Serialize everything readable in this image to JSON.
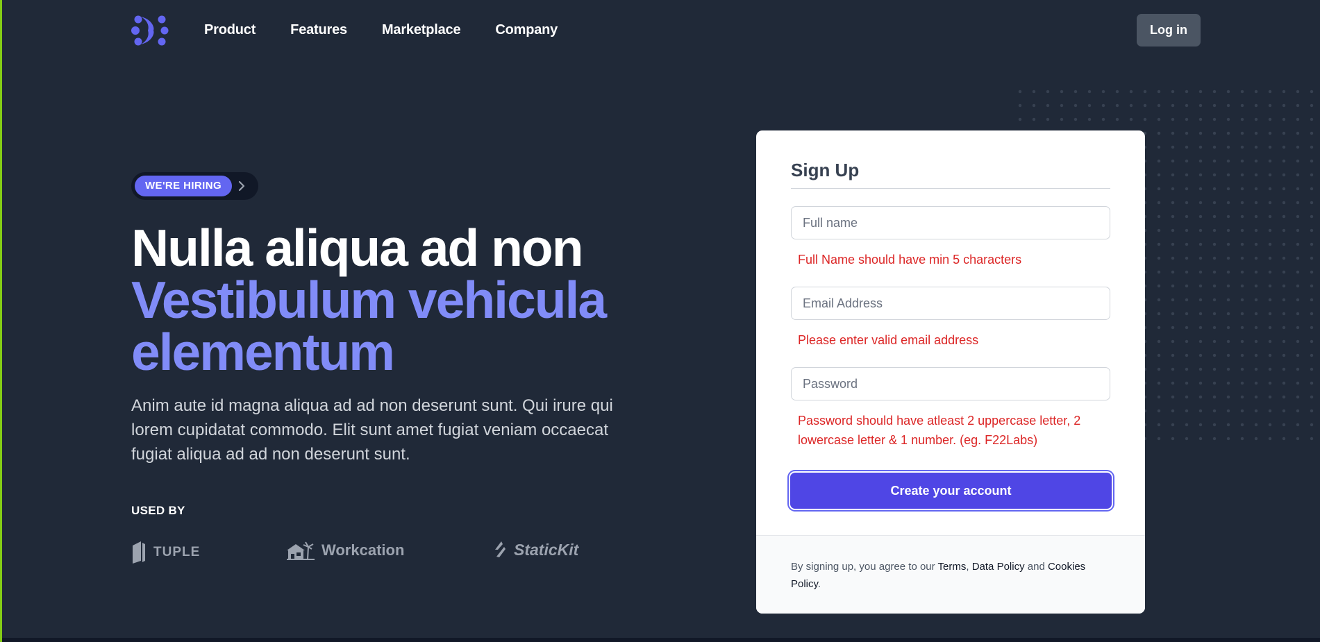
{
  "header": {
    "logo": "logo-mark",
    "nav": [
      "Product",
      "Features",
      "Marketplace",
      "Company"
    ],
    "login_label": "Log in"
  },
  "hero": {
    "badge": "WE'RE HIRING",
    "title_line1": "Nulla aliqua ad non",
    "title_line2": "Vestibulum vehicula",
    "title_line3": "elementum",
    "description": "Anim aute id magna aliqua ad ad non deserunt sunt. Qui irure qui lorem cupidatat commodo. Elit sunt amet fugiat veniam occaecat fugiat aliqua ad ad non deserunt sunt.",
    "used_by": "USED BY",
    "brands": [
      "TUPLE",
      "Workcation",
      "StaticKit"
    ]
  },
  "form": {
    "title": "Sign Up",
    "fullname_placeholder": "Full name",
    "fullname_error": "Full Name should have min 5 characters",
    "email_placeholder": "Email Address",
    "email_error": "Please enter valid email address",
    "password_placeholder": "Password",
    "password_error": "Password should have atleast 2 uppercase letter, 2 lowercase letter & 1 number. (eg. F22Labs)",
    "submit_label": "Create your account",
    "footer_prefix": "By signing up, you agree to our ",
    "terms": "Terms",
    "comma": ", ",
    "data_policy": "Data Policy",
    "and": " and ",
    "cookies_policy": "Cookies Policy",
    "period": "."
  },
  "colors": {
    "background": "#202938",
    "accent": "#6366f1",
    "accent_light": "#818cf8",
    "button": "#4f46e5",
    "error": "#dc2626"
  }
}
